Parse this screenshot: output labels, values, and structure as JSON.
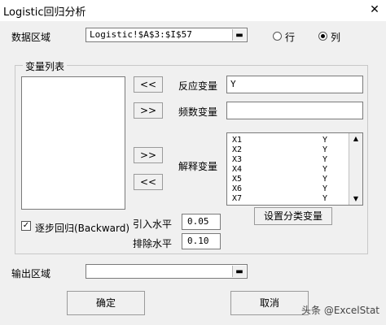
{
  "window": {
    "title": "Logistic回归分析",
    "close_glyph": "✕"
  },
  "data_range": {
    "label": "数据区域",
    "value": "Logistic!$A$3:$I$57",
    "dropdown_glyph": "▬"
  },
  "orientation": {
    "row_label": "行",
    "col_label": "列",
    "selected": "col"
  },
  "variables": {
    "title": "变量列表"
  },
  "buttons": {
    "to_left_1": "<<",
    "to_right_1": ">>",
    "to_right_2": ">>",
    "to_left_2": "<<",
    "set_category": "设置分类变量",
    "ok": "确定",
    "cancel": "取消"
  },
  "response": {
    "label": "反应变量",
    "value": "Y"
  },
  "frequency": {
    "label": "频数变量",
    "value": ""
  },
  "explanatory": {
    "label": "解释变量",
    "items": [
      {
        "name": "X1",
        "val": "Y"
      },
      {
        "name": "X2",
        "val": "Y"
      },
      {
        "name": "X3",
        "val": "Y"
      },
      {
        "name": "X4",
        "val": "Y"
      },
      {
        "name": "X5",
        "val": "Y"
      },
      {
        "name": "X6",
        "val": "Y"
      },
      {
        "name": "X7",
        "val": "Y"
      }
    ]
  },
  "stepwise": {
    "label": "逐步回归(Backward)",
    "checked": true,
    "check_glyph": "✓"
  },
  "entry": {
    "label": "引入水平",
    "value": "0.05"
  },
  "removal": {
    "label": "排除水平",
    "value": "0.10"
  },
  "output": {
    "label": "输出区域",
    "value": "",
    "dropdown_glyph": "▬"
  },
  "scroll": {
    "up": "▲",
    "down": "▼"
  },
  "watermark": "头条 @ExcelStat"
}
